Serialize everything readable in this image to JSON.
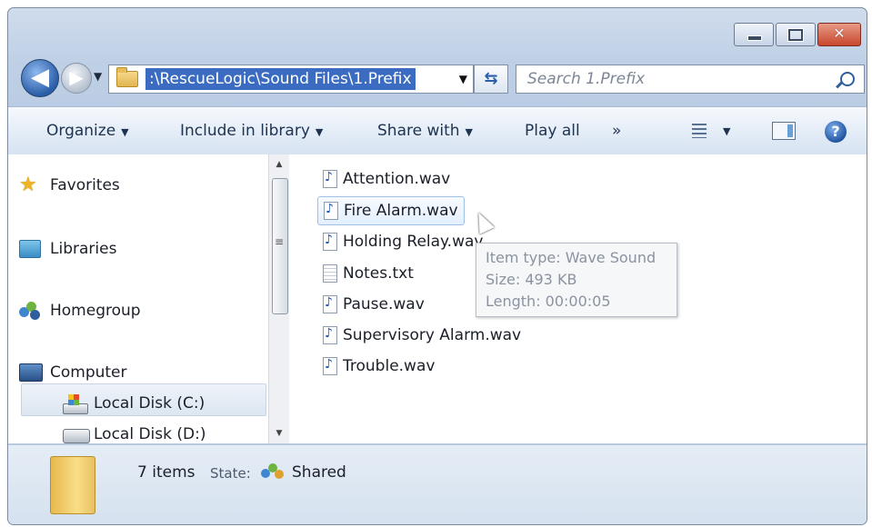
{
  "window": {
    "caption_buttons": {
      "minimize": "minimize",
      "maximize": "maximize",
      "close": "✕"
    }
  },
  "navigation": {
    "back_glyph": "◀",
    "address_path": ":\\RescueLogic\\Sound Files\\1.Prefix",
    "refresh_glyph": "⇆",
    "search_placeholder": "Search 1.Prefix"
  },
  "toolbar": {
    "organize": "Organize",
    "include_in_library": "Include in library",
    "share_with": "Share with",
    "play_all": "Play all",
    "more": "»"
  },
  "nav_pane": {
    "favorites": "Favorites",
    "libraries": "Libraries",
    "homegroup": "Homegroup",
    "computer": "Computer",
    "local_disk_c": "Local Disk (C:)",
    "local_disk_d": "Local Disk (D:)"
  },
  "files": [
    {
      "name": "Attention.wav",
      "type": "wav"
    },
    {
      "name": "Fire Alarm.wav",
      "type": "wav"
    },
    {
      "name": "Holding Relay.wav",
      "type": "wav"
    },
    {
      "name": "Notes.txt",
      "type": "txt"
    },
    {
      "name": "Pause.wav",
      "type": "wav"
    },
    {
      "name": "Supervisory Alarm.wav",
      "type": "wav"
    },
    {
      "name": "Trouble.wav",
      "type": "wav"
    }
  ],
  "tooltip": {
    "item_type": "Item type: Wave Sound",
    "size": "Size: 493 KB",
    "length": "Length: 00:00:05"
  },
  "details": {
    "count": "7 items",
    "state_label": "State:",
    "state_value": "Shared"
  },
  "colors": {
    "selection_blue": "#3b6cc1",
    "window_chrome": "#bfd0e6",
    "close_red": "#c8462c"
  }
}
